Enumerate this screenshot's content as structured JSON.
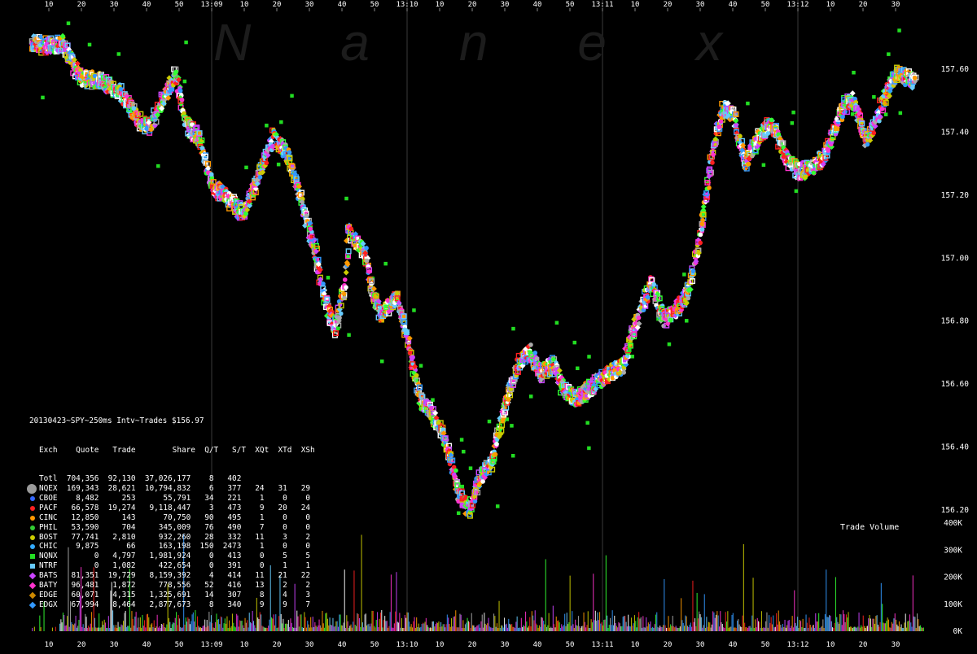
{
  "watermark": "Nanex",
  "time_axis": {
    "top_labels": [
      "10",
      "20",
      "30",
      "40",
      "50",
      "13:09",
      "10",
      "20",
      "30",
      "40",
      "50",
      "13:10",
      "10",
      "20",
      "30",
      "40",
      "50",
      "13:11",
      "10",
      "20",
      "30",
      "40",
      "50",
      "13:12",
      "10",
      "20",
      "30"
    ],
    "bottom_labels": [
      "10",
      "20",
      "30",
      "40",
      "50",
      "13:09",
      "10",
      "20",
      "30",
      "40",
      "50",
      "13:10",
      "10",
      "20",
      "30",
      "40",
      "50",
      "13:11",
      "10",
      "20",
      "30",
      "40",
      "50",
      "13:12",
      "10",
      "20",
      "30"
    ]
  },
  "stats_panel": {
    "title": "20130423~SPY~250ms Intv~Trades $156.97",
    "header": "Exch    Quote   Trade        Share  Q/T   S/T  XQt  XTd  XSh",
    "rows": [
      {
        "color": "#9a9a9a",
        "shape": "big",
        "text": "Totl  704,356  92,130  37,026,177    8   402"
      },
      {
        "color": "#9a9a9a",
        "shape": "big",
        "text": "NQEX  169,343  28,621  10,794,832    6   377   24   31   29"
      },
      {
        "color": "#3366ff",
        "shape": "dot",
        "text": "CBOE    8,482     253      55,791   34   221    1    0    0"
      },
      {
        "color": "#ff2020",
        "shape": "dot",
        "text": "PACF   66,578  19,274   9,118,447    3   473    9   20   24"
      },
      {
        "color": "#ff9900",
        "shape": "dot",
        "text": "CINC   12,850     143      70,750   90   495    1    0    0"
      },
      {
        "color": "#33cc33",
        "shape": "dot",
        "text": "PHIL   53,590     704     345,009   76   490    7    0    0"
      },
      {
        "color": "#cccc00",
        "shape": "dot",
        "text": "BOST   77,741   2,810     932,260   28   332   11    3    2"
      },
      {
        "color": "#33aaff",
        "shape": "dot",
        "text": "CHIC    9,875      66     163,198  150  2473    1    0    0"
      },
      {
        "color": "#22dd22",
        "shape": "sq",
        "text": "NQNX        0   4,797   1,981,924    0   413    0    5    5"
      },
      {
        "color": "#66ccff",
        "shape": "sq",
        "text": "NTRF        0   1,082     422,654    0   391    0    1    1"
      },
      {
        "color": "#cc44ff",
        "shape": "dia",
        "text": "BATS   81,351  19,729   8,159,392    4   414   11   21   22"
      },
      {
        "color": "#ff33cc",
        "shape": "dia",
        "text": "BATY   96,481   1,872     778,556   52   416   13    2    2"
      },
      {
        "color": "#cc8800",
        "shape": "dia",
        "text": "EDGE   60,071   4,315   1,325,691   14   307    8    4    3"
      },
      {
        "color": "#3399ff",
        "shape": "dia",
        "text": "EDGX   67,994   8,464   2,877,673    8   340    9    9    7"
      }
    ]
  },
  "chart_data": {
    "type": "scatter",
    "title": "20130423~SPY~250ms Intv~Trades $156.97",
    "ylabel": "",
    "y_ticks": [
      "157.60",
      "157.40",
      "157.20",
      "157.00",
      "156.80",
      "156.60",
      "156.40",
      "156.20"
    ],
    "ylim": [
      156.16,
      157.7
    ],
    "x_start": "13:08:05",
    "x_end": "13:12:36",
    "price_path": [
      [
        "13:08:05",
        157.68
      ],
      [
        "13:08:10",
        157.67
      ],
      [
        "13:08:14",
        157.68
      ],
      [
        "13:08:17",
        157.62
      ],
      [
        "13:08:20",
        157.57
      ],
      [
        "13:08:26",
        157.56
      ],
      [
        "13:08:32",
        157.52
      ],
      [
        "13:08:38",
        157.43
      ],
      [
        "13:08:41",
        157.41
      ],
      [
        "13:08:45",
        157.5
      ],
      [
        "13:08:49",
        157.58
      ],
      [
        "13:08:52",
        157.42
      ],
      [
        "13:08:56",
        157.38
      ],
      [
        "13:08:59",
        157.27
      ],
      [
        "13:09:01",
        157.22
      ],
      [
        "13:09:04",
        157.2
      ],
      [
        "13:09:08",
        157.15
      ],
      [
        "13:09:10",
        157.14
      ],
      [
        "13:09:14",
        157.25
      ],
      [
        "13:09:19",
        157.38
      ],
      [
        "13:09:23",
        157.33
      ],
      [
        "13:09:27",
        157.2
      ],
      [
        "13:09:32",
        157.01
      ],
      [
        "13:09:35",
        156.85
      ],
      [
        "13:09:38",
        156.77
      ],
      [
        "13:09:41",
        156.92
      ],
      [
        "13:09:42",
        157.08
      ],
      [
        "13:09:47",
        157.02
      ],
      [
        "13:09:49",
        156.9
      ],
      [
        "13:09:52",
        156.82
      ],
      [
        "13:09:57",
        156.87
      ],
      [
        "13:10:00",
        156.75
      ],
      [
        "13:10:04",
        156.55
      ],
      [
        "13:10:09",
        156.48
      ],
      [
        "13:10:13",
        156.38
      ],
      [
        "13:10:16",
        156.24
      ],
      [
        "13:10:19",
        156.2
      ],
      [
        "13:10:22",
        156.29
      ],
      [
        "13:10:26",
        156.35
      ],
      [
        "13:10:30",
        156.53
      ],
      [
        "13:10:34",
        156.66
      ],
      [
        "13:10:38",
        156.7
      ],
      [
        "13:10:41",
        156.63
      ],
      [
        "13:10:45",
        156.66
      ],
      [
        "13:10:48",
        156.58
      ],
      [
        "13:10:52",
        156.55
      ],
      [
        "13:10:58",
        156.6
      ],
      [
        "13:11:02",
        156.63
      ],
      [
        "13:11:06",
        156.65
      ],
      [
        "13:11:10",
        156.78
      ],
      [
        "13:11:15",
        156.92
      ],
      [
        "13:11:19",
        156.8
      ],
      [
        "13:11:22",
        156.83
      ],
      [
        "13:11:26",
        156.88
      ],
      [
        "13:11:28",
        156.96
      ],
      [
        "13:11:31",
        157.14
      ],
      [
        "13:11:34",
        157.35
      ],
      [
        "13:11:37",
        157.47
      ],
      [
        "13:11:40",
        157.46
      ],
      [
        "13:11:44",
        157.3
      ],
      [
        "13:11:48",
        157.38
      ],
      [
        "13:11:52",
        157.43
      ],
      [
        "13:11:56",
        157.32
      ],
      [
        "13:12:00",
        157.27
      ],
      [
        "13:12:04",
        157.28
      ],
      [
        "13:12:08",
        157.32
      ],
      [
        "13:12:11",
        157.4
      ],
      [
        "13:12:14",
        157.48
      ],
      [
        "13:12:17",
        157.5
      ],
      [
        "13:12:21",
        157.37
      ],
      [
        "13:12:24",
        157.43
      ],
      [
        "13:12:27",
        157.52
      ],
      [
        "13:12:30",
        157.58
      ],
      [
        "13:12:33",
        157.57
      ],
      [
        "13:12:36",
        157.56
      ]
    ],
    "volume_panel": {
      "label": "Trade Volume",
      "y_ticks": [
        "400K",
        "300K",
        "200K",
        "100K",
        "0K"
      ],
      "ylim": [
        0,
        400000
      ]
    },
    "grid": "vertical lines at 13:09, 13:10, 13:11, 13:12"
  },
  "colors": {
    "background": "#000000",
    "grid": "#3a3a3a",
    "watermark": "#1c1c1c",
    "palette": [
      "#33ff33",
      "#ffffff",
      "#ff2020",
      "#ff33cc",
      "#cc44ff",
      "#3399ff",
      "#ff9900",
      "#66ccff",
      "#cccc00",
      "#aaaaaa"
    ]
  }
}
